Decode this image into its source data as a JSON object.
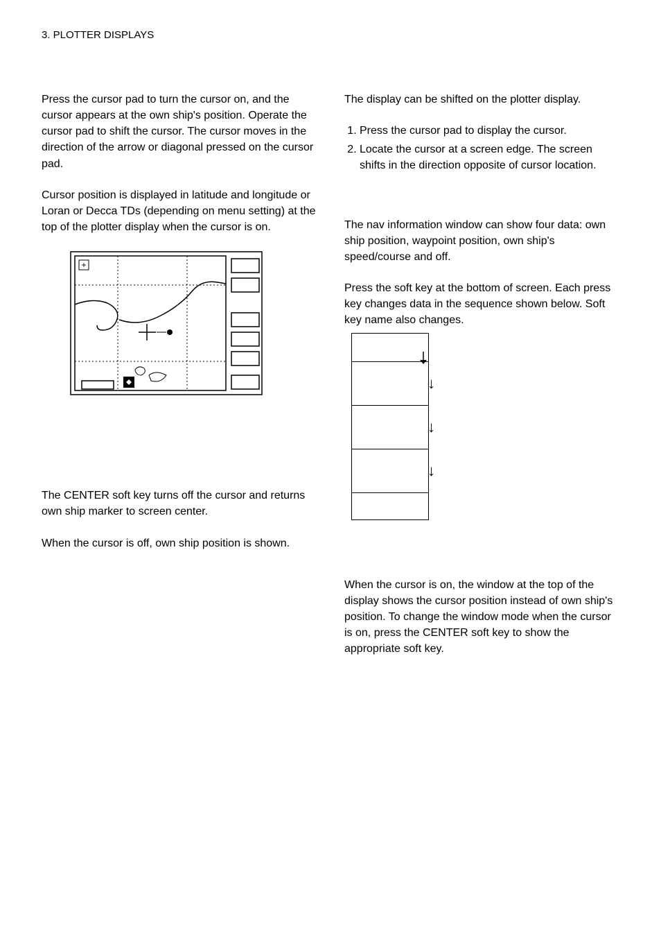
{
  "header": "3. PLOTTER DISPLAYS",
  "left": {
    "p1": "Press the cursor pad to turn the cursor on, and the cursor appears at the own ship's position. Operate the cursor pad to shift the cursor. The cursor moves in the direction of the arrow or diagonal pressed on the cursor pad.",
    "p2": "Cursor position is displayed in latitude and longitude or Loran or Decca TDs (depending on menu setting) at the top of the plotter display when the cursor is on.",
    "p3": "The CENTER soft key turns off the cursor and returns own ship marker to screen center.",
    "p4": "When the cursor is off, own ship position is shown."
  },
  "right": {
    "p1": "The display can be shifted on the plotter display.",
    "list": [
      "Press the cursor pad to display the cursor.",
      "Locate the cursor at a screen edge. The screen shifts in the direction opposite of cursor location."
    ],
    "p2": "The nav information window can show four data: own ship position, waypoint position, own ship's speed/course and off.",
    "p3": "Press the soft key at the bottom of screen. Each press key changes data in the sequence shown below. Soft key name also changes.",
    "p4": "When the cursor is on, the window at the top of the display shows the cursor position instead of own ship's position. To change the window mode when the cursor is on, press the CENTER soft key to show the appropriate soft key."
  },
  "figure": {
    "plus": "+"
  }
}
